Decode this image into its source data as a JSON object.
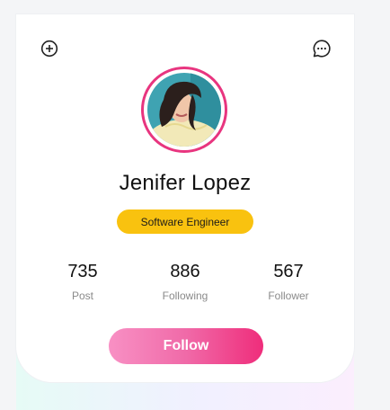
{
  "header": {
    "add_icon": "add-circle-icon",
    "chat_icon": "chat-bubble-icon"
  },
  "profile": {
    "name": "Jenifer Lopez",
    "role": "Software Engineer",
    "avatar": "profile-photo"
  },
  "stats": [
    {
      "value": "735",
      "label": "Post"
    },
    {
      "value": "886",
      "label": "Following"
    },
    {
      "value": "567",
      "label": "Follower"
    }
  ],
  "actions": {
    "follow_label": "Follow"
  },
  "colors": {
    "ring": "#e8357f",
    "badge": "#f9c20f",
    "button_start": "#f890c4",
    "button_end": "#ef2d7b"
  }
}
